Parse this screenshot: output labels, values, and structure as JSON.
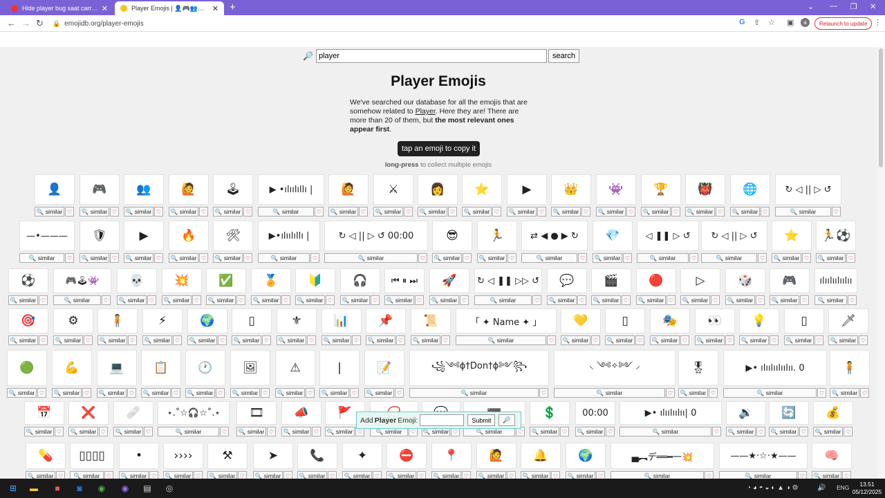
{
  "browser": {
    "tabs": [
      {
        "title": "Hide player bug saat carry orang",
        "active": false
      },
      {
        "title": "Player Emojis | 👤🎮👥🕹 | Copy",
        "active": true
      }
    ],
    "url": "emojidb.org/player-emojis",
    "relaunch_label": "Relaunch to update",
    "profile_initial": "a"
  },
  "search": {
    "value": "player",
    "button": "search"
  },
  "page": {
    "title": "Player Emojis",
    "intro_1": "We've searched our database for all the emojis that are somehow related to ",
    "intro_link": "Player",
    "intro_2": ". Here they are! There are more than 20 of them, but ",
    "intro_bold": "the most relevant ones appear first",
    "intro_end": ".",
    "copy_hint": "tap an emoji to copy it",
    "longpress_bold": "long-press",
    "longpress_rest": " to collect multiple emojis",
    "similar_label": "similar",
    "heart_icon": "♡"
  },
  "add_emoji": {
    "label_pre": "Add ",
    "label_bold": "Player",
    "label_post": " Emoji:",
    "submit": "Submit",
    "search_icon": "🔎"
  },
  "emojis": [
    {
      "row": 0,
      "items": [
        "👤",
        "🎮",
        "👥",
        "🙋",
        "🕹",
        "▶ •ılıılıllı |",
        "🙋",
        "⚔",
        "👩",
        "⭐",
        "▶",
        "👑",
        "👾",
        "🏆",
        "👹",
        "🌐",
        "↻ ◁ || ▷ ↺"
      ]
    },
    {
      "row": 1,
      "items": [
        "—•———",
        "🛡",
        "▶",
        "🔥",
        "🛠",
        "▶•ılıılıllı |",
        "↻ ◁ || ▷ ↺ 00:00",
        "😎",
        "🏃",
        "⇄ ◀ ● ▶ ↻",
        "💎",
        "◁ ❚❚ ▷ ↺",
        "↻ ◁ || ▷ ↺",
        "⭐",
        "🏃⚽"
      ]
    },
    {
      "row": 2,
      "items": [
        "⚽",
        "🎮🕹👾",
        "💀",
        "💥",
        "✅",
        "🏅",
        "🔰",
        "🎧",
        "⏮ ⏸ ⏭",
        "🚀",
        "↻ ◁ ❚❚ ▷▷ ↺",
        "💬",
        "🎬",
        "🔴",
        "▷",
        "🎲",
        "🎮",
        "ılıılıılıılıı"
      ]
    },
    {
      "row": 3,
      "items": [
        "🎯",
        "⚙",
        "🧍",
        "⚡",
        "🌍",
        "▯",
        "⚜",
        "📊",
        "📌",
        "📜",
        "「 ✦ Name ✦ 」",
        "💛",
        "▯",
        "🎭",
        "👀",
        "💡",
        "▯",
        "🗡"
      ]
    },
    {
      "row": 4,
      "items": [
        "🟢",
        "💪",
        "💻",
        "📋",
        "🕐",
        "🖼",
        "⚠",
        "|",
        "📝",
        "꧁༺ɸ†Don†ɸ༻꧂",
        "⸜ ༺✧༻ ⸝",
        "🎖",
        "▶• ılıılıılıılıı. 0",
        "🧍"
      ]
    },
    {
      "row": 5,
      "items": [
        "📅",
        "❌",
        "🩹",
        "⋆.˚☆🎧☆˚.⋆",
        "🎞",
        "📣",
        "🚩",
        "📿",
        "💬",
        "🟰",
        "💲",
        "00:00",
        "▶• ılıılıılıı| 0",
        "🔉",
        "🔄",
        "💰"
      ]
    },
    {
      "row": 6,
      "items": [
        "💊",
        "▯▯▯▯",
        "•",
        "››››",
        "⚒",
        "➤",
        "📞",
        "✦",
        "⛔",
        "📍",
        "🙋",
        "🔔",
        "🌍",
        "▄︻デ══━一💥",
        "——★·☆·★——",
        "🧠"
      ]
    }
  ],
  "taskbar": {
    "apps": [
      "windows-logo",
      "file-explorer",
      "folder",
      "outlook",
      "chrome",
      "browser-purple",
      "terminal",
      "app-circle"
    ],
    "tray_lang": "ENG",
    "time": "13.51",
    "date": "05/12/2025"
  }
}
